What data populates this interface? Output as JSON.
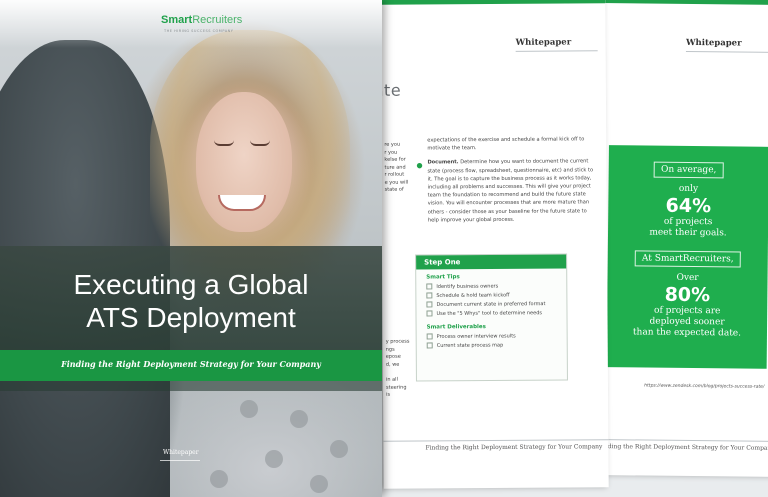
{
  "cover": {
    "brand_name_part1": "Smart",
    "brand_name_part2": "Recruiters",
    "brand_tagline": "THE HIRING SUCCESS COMPANY",
    "title_line1": "Executing a Global",
    "title_line2": "ATS Deployment",
    "subtitle": "Finding the Right Deployment Strategy for Your Company",
    "doc_type": "Whitepaper"
  },
  "page2": {
    "header": "Whitepaper",
    "heading_fragment": "tate",
    "left_fragments_top": [
      "re you",
      "r you",
      "kelse for",
      "ture and",
      "r rollout",
      "e you will",
      "state of"
    ],
    "left_fragments_bottom": [
      "y process",
      "ngs",
      "epose",
      "d, we",
      "in all",
      "steering",
      "is"
    ],
    "intro_text": "expectations of the exercise and schedule a formal kick off to motivate the team.",
    "bullet_label": "Document.",
    "bullet_text": "Determine how you want to document the current state (process flow, spreadsheet, questionnaire, etc) and stick to it. The goal is to capture the business process as it works today, including all problems and successes. This will give your project team the foundation to recommend and build the future state vision. You will encounter processes that are more mature than others - consider those as your baseline for the future state to help improve your global process.",
    "step_title": "Step One",
    "tips_label": "Smart Tips",
    "tips": [
      "Identify business owners",
      "Schedule & hold team kickoff",
      "Document current state in preferred format",
      "Use the \"5 Whys\" tool to determine needs"
    ],
    "deliverables_label": "Smart Deliverables",
    "deliverables": [
      "Process owner interview results",
      "Current state process map"
    ],
    "footer": "Finding the Right Deployment Strategy for Your Company"
  },
  "page3": {
    "header": "Whitepaper",
    "stat1_pill": "On average,",
    "stat1_pre": "only",
    "stat1_value": "64%",
    "stat1_post_line1": "of projects",
    "stat1_post_line2": "meet their goals.",
    "stat2_pill": "At SmartRecruiters,",
    "stat2_pre": "Over",
    "stat2_value": "80%",
    "stat2_post_line1": "of projects are",
    "stat2_post_line2": "deployed sooner",
    "stat2_post_line3": "than the expected date.",
    "citation": "https://www.zendesk.com/blog/projects-success-rate/",
    "footer": "Finding the Right Deployment Strategy for Your Company"
  },
  "colors": {
    "brand_green": "#20a14b",
    "stat_green": "#1fae4e",
    "band_dark": "#3a4842"
  }
}
